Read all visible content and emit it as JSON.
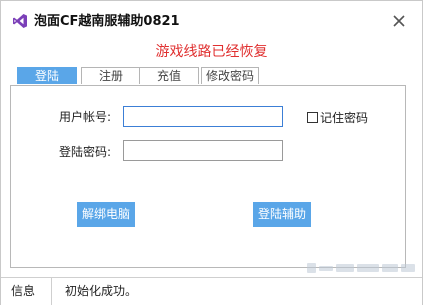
{
  "window": {
    "title": "泡面CF越南服辅助0821",
    "icon": "visual-studio-icon",
    "close_icon": "close-icon"
  },
  "banner": {
    "message": "游戏线路已经恢复",
    "color": "#e03030"
  },
  "tabs": [
    {
      "label": "登陆",
      "active": true
    },
    {
      "label": "注册",
      "active": false
    },
    {
      "label": "充值",
      "active": false
    },
    {
      "label": "修改密码",
      "active": false
    }
  ],
  "form": {
    "account_label": "用户帐号:",
    "account_value": "",
    "password_label": "登陆密码:",
    "password_value": "",
    "remember_label": "记住密码",
    "remember_checked": false
  },
  "buttons": {
    "unbind": "解绑电脑",
    "login": "登陆辅助"
  },
  "statusbar": {
    "label": "信息",
    "message": "初始化成功。"
  },
  "colors": {
    "accent": "#5aa6e8",
    "alert": "#e03030"
  }
}
